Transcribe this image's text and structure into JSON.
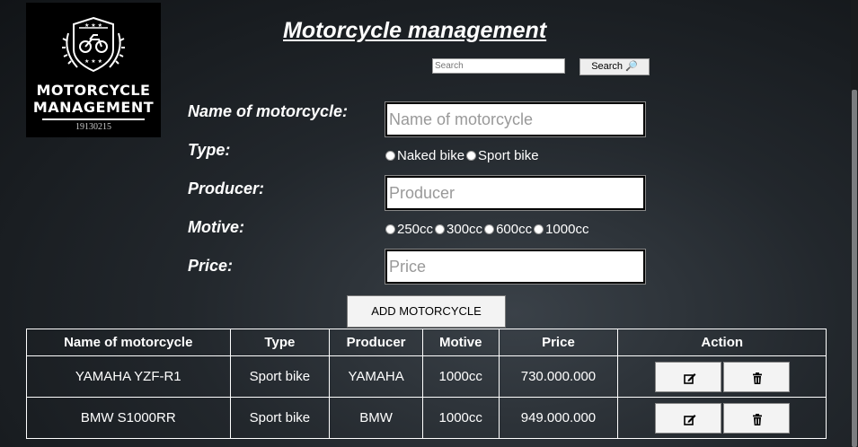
{
  "logo": {
    "line1": "MOTORCYCLE",
    "line2": "MANAGEMENT",
    "code": "19130215"
  },
  "title": "Motorcycle management",
  "search": {
    "placeholder": "Search",
    "button_label": "Search 🔎"
  },
  "form": {
    "name_label": "Name of motorcycle:",
    "name_placeholder": "Name of motorcycle",
    "type_label": "Type:",
    "type_options": [
      "Naked bike",
      "Sport bike"
    ],
    "producer_label": "Producer:",
    "producer_placeholder": "Producer",
    "motive_label": "Motive:",
    "motive_options": [
      "250cc",
      "300cc",
      "600cc",
      "1000cc"
    ],
    "price_label": "Price:",
    "price_placeholder": "Price",
    "add_button": "ADD MOTORCYCLE"
  },
  "table": {
    "headers": [
      "Name of motorcycle",
      "Type",
      "Producer",
      "Motive",
      "Price",
      "Action"
    ],
    "rows": [
      [
        "YAMAHA YZF-R1",
        "Sport bike",
        "YAMAHA",
        "1000cc",
        "730.000.000"
      ],
      [
        "BMW S1000RR",
        "Sport bike",
        "BMW",
        "1000cc",
        "949.000.000"
      ]
    ]
  },
  "icons": {
    "edit": "edit-icon",
    "delete": "trash-icon",
    "search": "magnifier-icon"
  }
}
